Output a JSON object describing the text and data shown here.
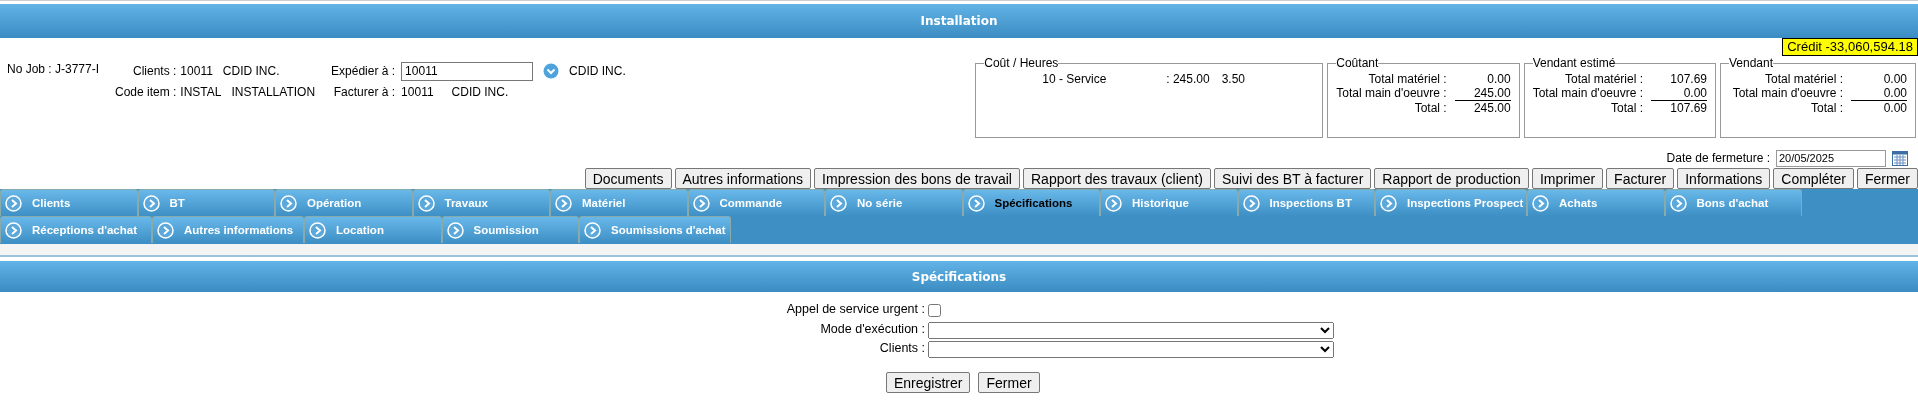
{
  "title": "Installation",
  "credit": "Crédit -33,060,594.18",
  "info": {
    "job": "No Job : J-3777-I",
    "clients_label": "Clients :",
    "clients_code": "10011",
    "clients_name": "CDID INC.",
    "item_label": "Code item :",
    "item_code": "INSTAL",
    "item_name": "INSTALLATION",
    "ship_label": "Expédier à :",
    "ship_value": "10011",
    "ship_name": "CDID INC.",
    "bill_label": "Facturer à :",
    "bill_code": "10011",
    "bill_name": "CDID INC."
  },
  "hours": {
    "legend": "Coût / Heures",
    "rows": [
      {
        "name": "10 - Service",
        "amount": ": 245.00",
        "hours": "3.50"
      }
    ]
  },
  "totals": [
    {
      "legend": "Coûtant",
      "rows": [
        {
          "label": "Total matériel :",
          "value": "0.00"
        },
        {
          "label": "Total main d'oeuvre :",
          "value": "245.00"
        },
        {
          "label": "Total :",
          "value": "245.00"
        }
      ]
    },
    {
      "legend": "Vendant estimé",
      "rows": [
        {
          "label": "Total matériel :",
          "value": "107.69"
        },
        {
          "label": "Total main d'oeuvre :",
          "value": "0.00"
        },
        {
          "label": "Total :",
          "value": "107.69"
        }
      ]
    },
    {
      "legend": "Vendant",
      "rows": [
        {
          "label": "Total matériel :",
          "value": "0.00"
        },
        {
          "label": "Total main d'oeuvre :",
          "value": "0.00"
        },
        {
          "label": "Total :",
          "value": "0.00"
        }
      ]
    }
  ],
  "closing_date": {
    "label": "Date de fermeture :",
    "value": "20/05/2025"
  },
  "actions": [
    "Documents",
    "Autres informations",
    "Impression des bons de travail",
    "Rapport des travaux (client)",
    "Suivi des BT à facturer",
    "Rapport de production",
    "Imprimer",
    "Facturer",
    "Informations",
    "Compléter",
    "Fermer"
  ],
  "tab_rows": [
    [
      {
        "label": "Clients",
        "selected": false
      },
      {
        "label": "BT",
        "selected": false
      },
      {
        "label": "Opération",
        "selected": false
      },
      {
        "label": "Travaux",
        "selected": false
      },
      {
        "label": "Matériel",
        "selected": false
      },
      {
        "label": "Commande",
        "selected": false
      },
      {
        "label": "No série",
        "selected": false
      },
      {
        "label": "Spécifications",
        "selected": true
      },
      {
        "label": "Historique",
        "selected": false
      },
      {
        "label": "Inspections BT",
        "selected": false
      },
      {
        "label": "Inspections Prospect",
        "selected": false
      },
      {
        "label": "Achats",
        "selected": false
      },
      {
        "label": "Bons d'achat",
        "selected": false
      }
    ],
    [
      {
        "label": "Réceptions d'achat",
        "selected": false
      },
      {
        "label": "Autres informations",
        "selected": false
      },
      {
        "label": "Location",
        "selected": false
      },
      {
        "label": "Soumission",
        "selected": false
      },
      {
        "label": "Soumissions d'achat",
        "selected": false
      }
    ]
  ],
  "section": {
    "title": "Spécifications",
    "fields": [
      {
        "kind": "checkbox",
        "label": "Appel de service urgent :",
        "checked": false
      },
      {
        "kind": "select",
        "label": "Mode d'exécution :"
      },
      {
        "kind": "select",
        "label": "Clients :"
      }
    ],
    "buttons": [
      "Enregistrer",
      "Fermer"
    ]
  }
}
